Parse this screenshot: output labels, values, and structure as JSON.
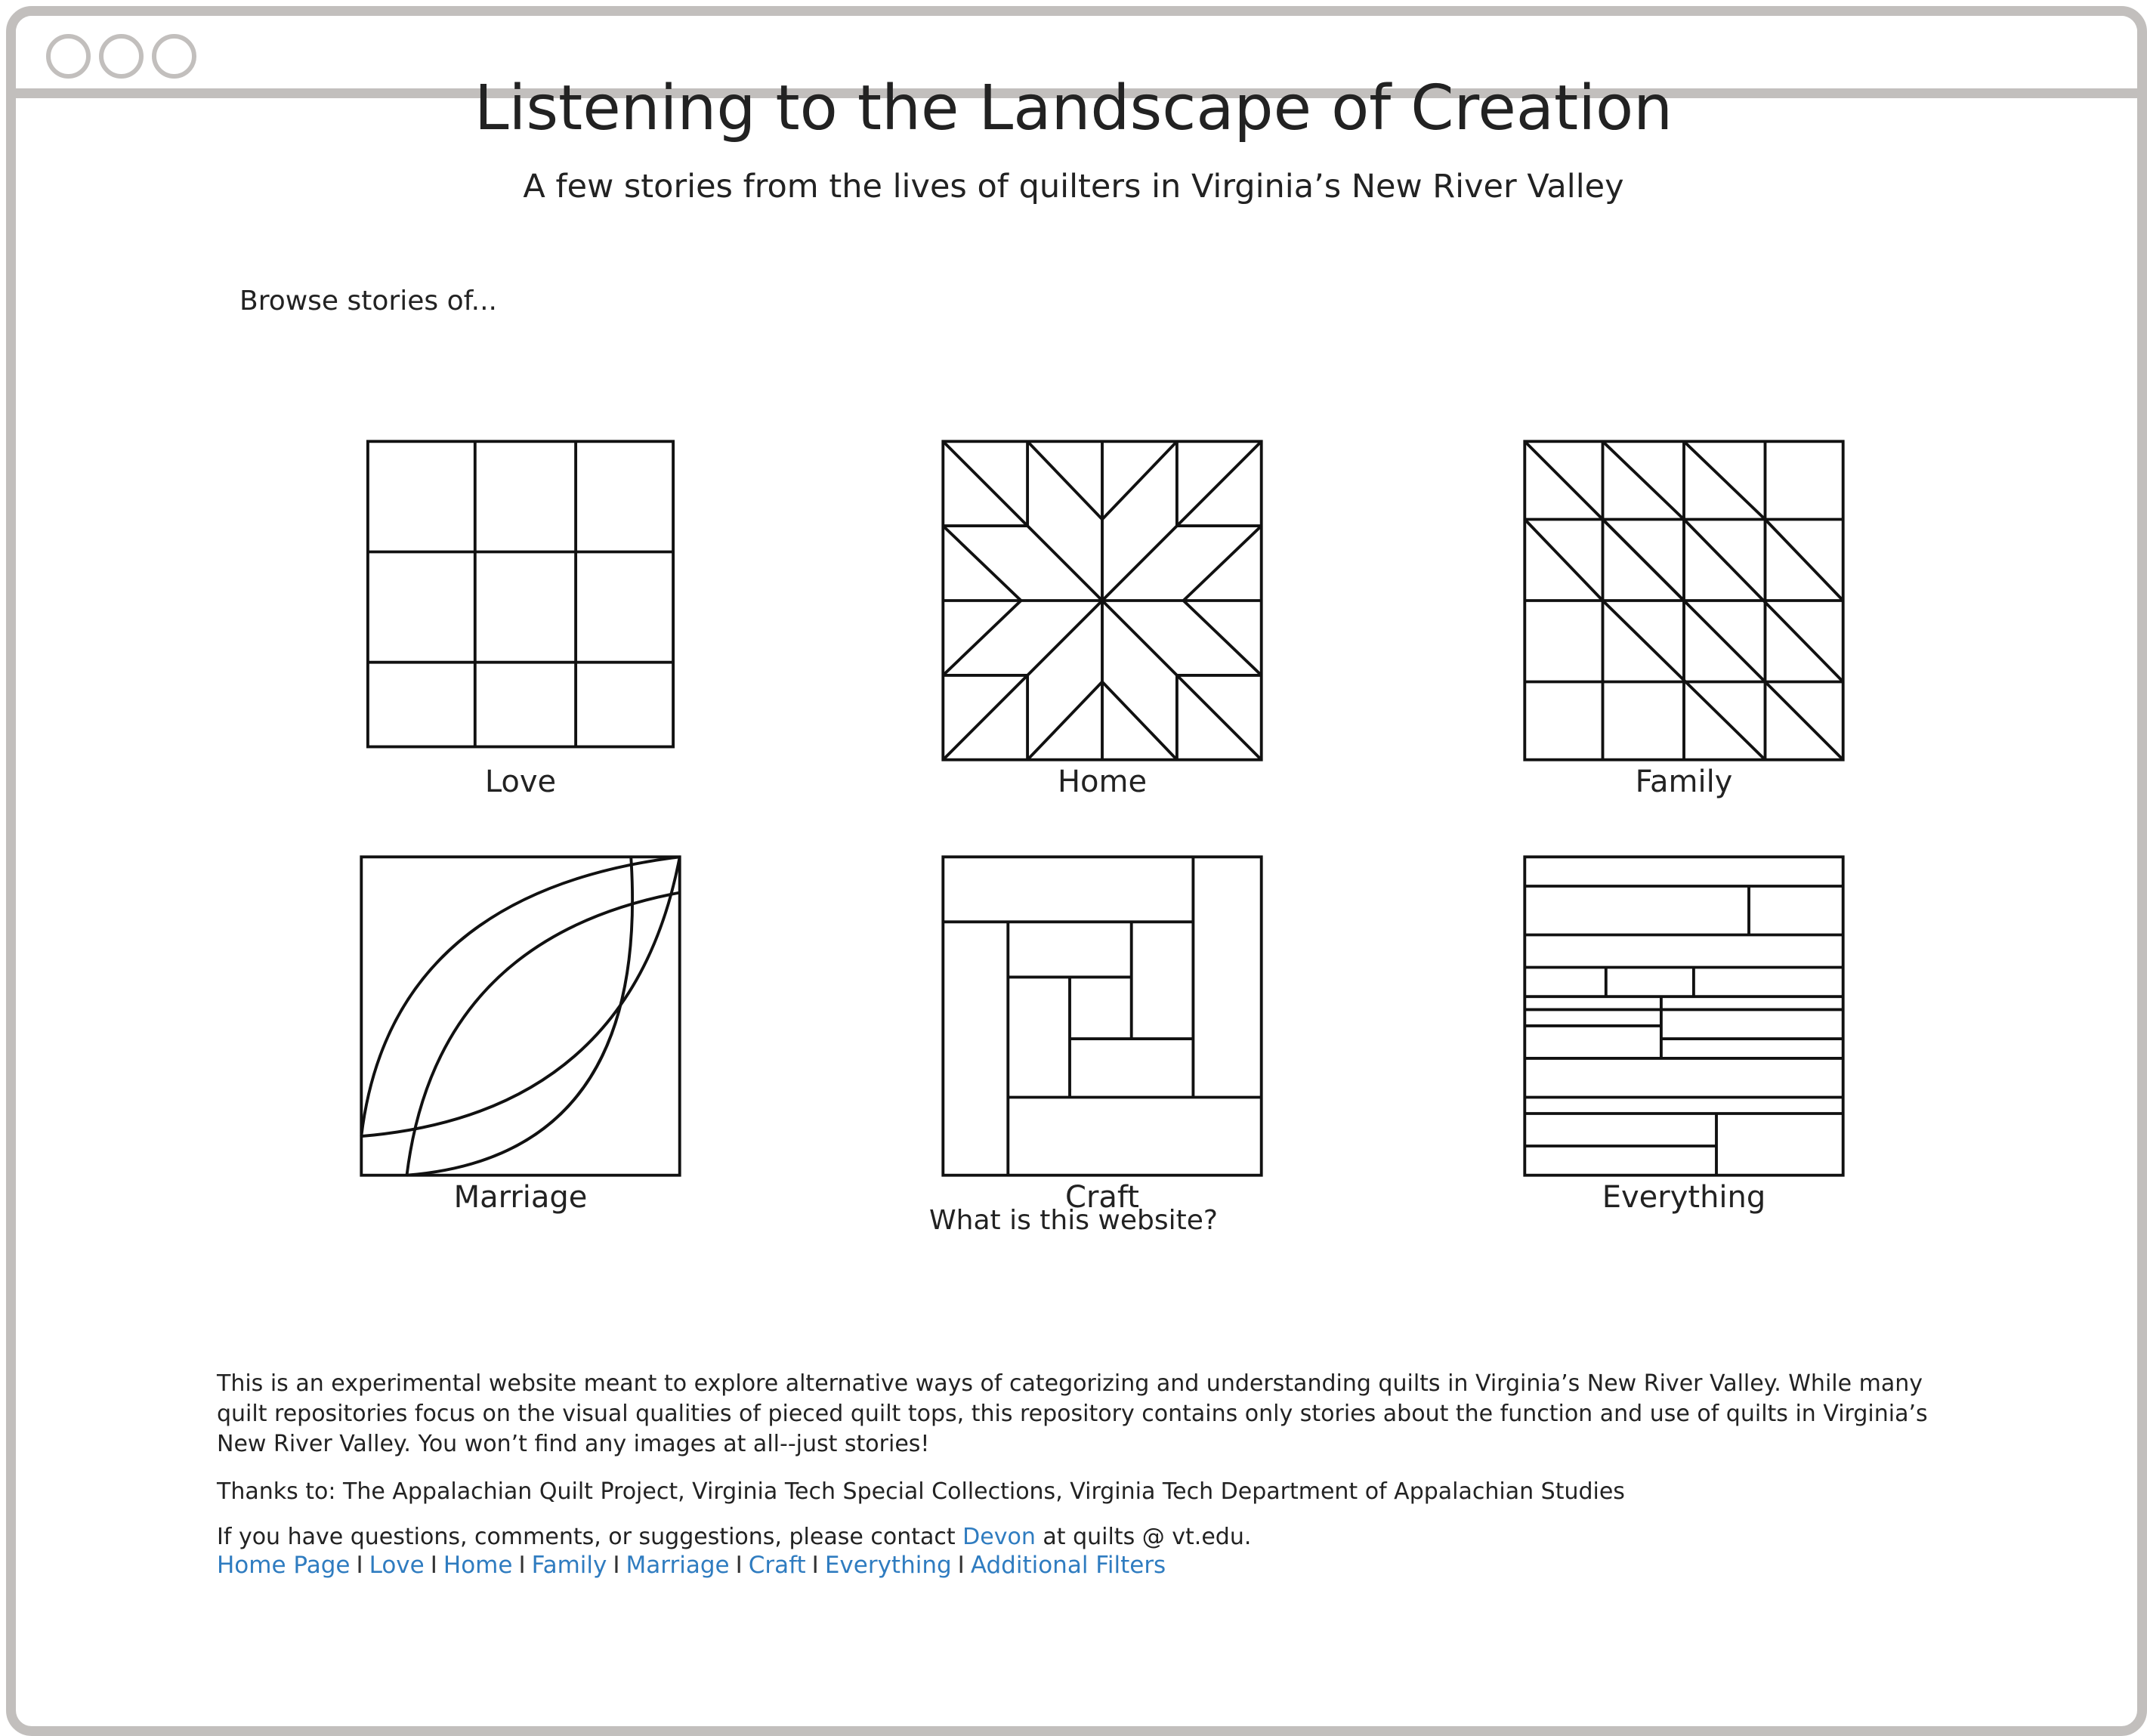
{
  "header": {
    "title": "Listening to the Landscape of Creation",
    "subtitle": "A few stories from the lives of quilters in Virginia’s New River Valley"
  },
  "browse": {
    "label": "Browse stories of...",
    "categories": [
      "Love",
      "Home",
      "Family",
      "Marriage",
      "Craft",
      "Everything"
    ]
  },
  "about": {
    "heading": "What is this website?",
    "description": "This is an experimental website meant to explore alternative ways of categorizing and understanding quilts in Virginia’s New River Valley. While many quilt repositories focus on the visual qualities of pieced quilt tops, this repository contains only stories about the function and use of quilts in Virginia’s New River Valley. You won’t find any images at all--just stories!",
    "thanks": "Thanks to: The Appalachian Quilt Project, Virginia Tech Special Collections, Virginia Tech Department of Appalachian Studies",
    "contact_before": "If you have questions, comments, or suggestions, please contact",
    "contact_link": "Devon",
    "contact_after": "at quilts @ vt.edu."
  },
  "footer": {
    "links": [
      "Home Page",
      "Love",
      "Home",
      "Family",
      "Marriage",
      "Craft",
      "Everything",
      "Additional Filters"
    ],
    "separator": "I"
  },
  "colors": {
    "link": "#2f7cc0",
    "window_border": "#c2bfbd",
    "text": "#222222"
  },
  "icons": [
    "nine-patch-quilt-icon",
    "star-quilt-icon",
    "triangles-quilt-icon",
    "double-wedding-ring-quilt-icon",
    "log-cabin-quilt-icon",
    "strip-quilt-icon"
  ]
}
